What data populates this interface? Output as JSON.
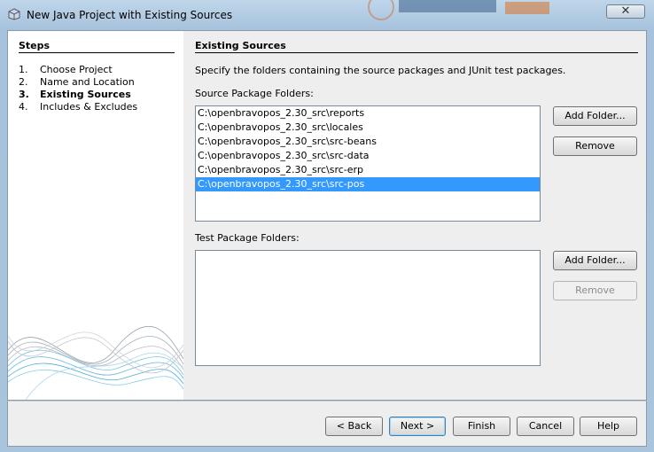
{
  "window": {
    "title": "New Java Project with Existing Sources",
    "close_symbol": "✕"
  },
  "steps": {
    "heading": "Steps",
    "items": [
      {
        "num": "1.",
        "label": "Choose Project"
      },
      {
        "num": "2.",
        "label": "Name and Location"
      },
      {
        "num": "3.",
        "label": "Existing Sources"
      },
      {
        "num": "4.",
        "label": "Includes & Excludes"
      }
    ]
  },
  "main": {
    "heading": "Existing Sources",
    "description": "Specify the folders containing the source packages and JUnit test packages.",
    "source_label": "Source Package Folders:",
    "source_folders": [
      "C:\\openbravopos_2.30_src\\reports",
      "C:\\openbravopos_2.30_src\\locales",
      "C:\\openbravopos_2.30_src\\src-beans",
      "C:\\openbravopos_2.30_src\\src-data",
      "C:\\openbravopos_2.30_src\\src-erp",
      "C:\\openbravopos_2.30_src\\src-pos"
    ],
    "test_label": "Test Package Folders:",
    "add_folder": "Add Folder...",
    "remove": "Remove"
  },
  "nav": {
    "back": "< Back",
    "next": "Next >",
    "finish": "Finish",
    "cancel": "Cancel",
    "help": "Help"
  },
  "colors": {
    "selection": "#3399ff",
    "titlebar": "#bfd6ea"
  }
}
